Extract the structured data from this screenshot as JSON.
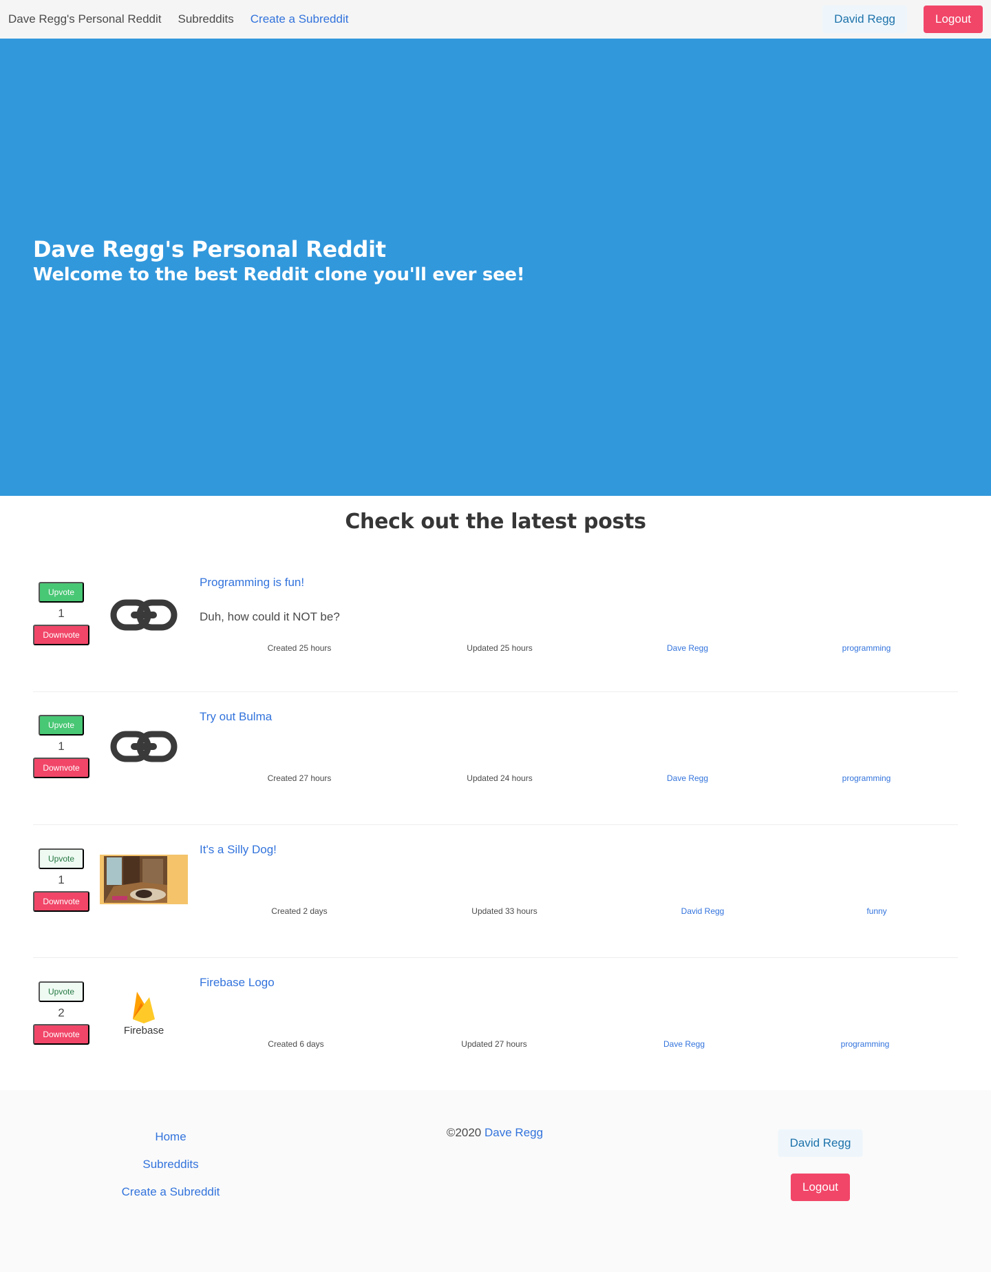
{
  "navbar": {
    "brand": "Dave Regg's Personal Reddit",
    "subreddits": "Subreddits",
    "create_subreddit": "Create a Subreddit",
    "user": "David Regg",
    "logout": "Logout"
  },
  "hero": {
    "title": "Dave Regg's Personal Reddit",
    "subtitle": "Welcome to the best Reddit clone you'll ever see!",
    "background": "#3298dc"
  },
  "section_title": "Check out the latest posts",
  "posts": [
    {
      "upvote_label": "Upvote",
      "downvote_label": "Downvote",
      "score": "1",
      "thumbnail": "link-icon",
      "title": "Programming is fun!",
      "body": "Duh, how could it NOT be?",
      "created": "Created 25 hours",
      "updated": "Updated 25 hours",
      "author": "Dave Regg",
      "subreddit": "programming"
    },
    {
      "upvote_label": "Upvote",
      "downvote_label": "Downvote",
      "score": "1",
      "thumbnail": "link-icon",
      "title": "Try out Bulma",
      "body": "",
      "created": "Created 27 hours",
      "updated": "Updated 24 hours",
      "author": "Dave Regg",
      "subreddit": "programming"
    },
    {
      "upvote_label": "Upvote",
      "downvote_label": "Downvote",
      "score": "1",
      "thumbnail": "dog-photo",
      "title": "It's a Silly Dog!",
      "body": "",
      "created": "Created 2 days",
      "updated": "Updated 33 hours",
      "author": "David Regg",
      "subreddit": "funny"
    },
    {
      "upvote_label": "Upvote",
      "downvote_label": "Downvote",
      "score": "2",
      "thumbnail": "firebase-logo",
      "thumbnail_text": "Firebase",
      "title": "Firebase Logo",
      "body": "",
      "created": "Created 6 days",
      "updated": "Updated 27 hours",
      "author": "Dave Regg",
      "subreddit": "programming"
    }
  ],
  "footer": {
    "links": [
      "Home",
      "Subreddits",
      "Create a Subreddit"
    ],
    "copyright": "©2020",
    "copyright_name": "Dave Regg",
    "user": "David Regg",
    "logout": "Logout"
  },
  "colors": {
    "primary": "#3273dc",
    "info": "#3298dc",
    "success": "#48c774",
    "danger": "#f14668"
  }
}
